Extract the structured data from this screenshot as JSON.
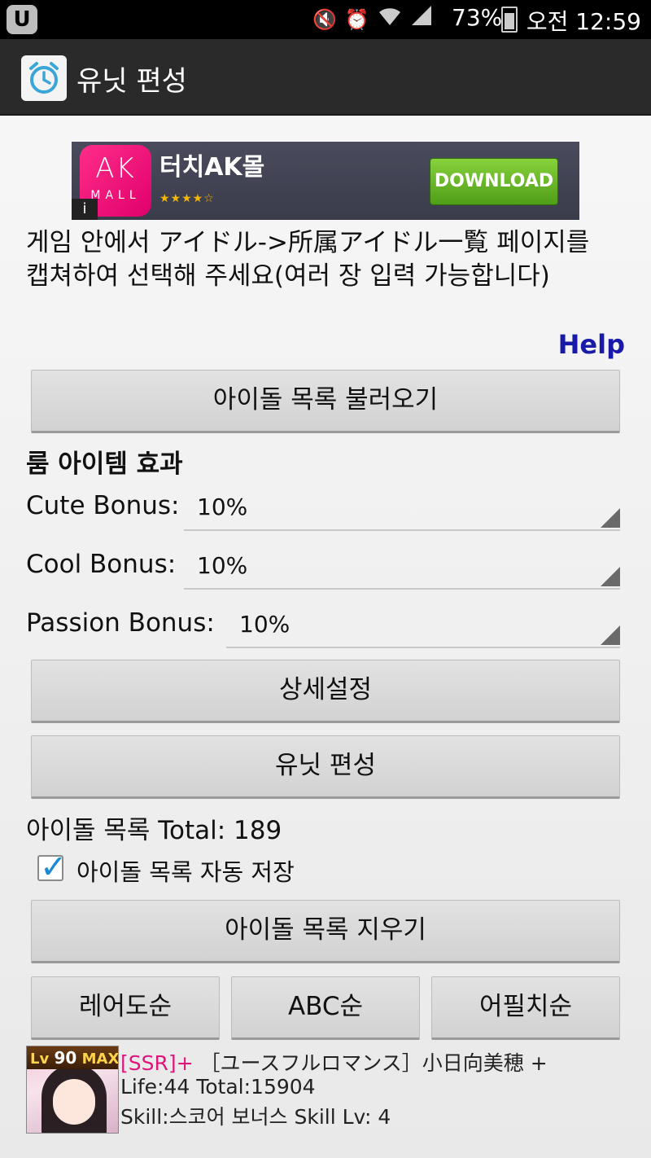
{
  "status_bar": {
    "battery": "73%",
    "time": "오전 12:59"
  },
  "action_bar": {
    "title": "유닛 편성"
  },
  "ad": {
    "logo_text": "AK",
    "logo_subtext": "MALL",
    "info_label": "i",
    "name": "터치AK몰",
    "stars": "★★★★☆",
    "download_label": "DOWNLOAD"
  },
  "instructions": "게임 안에서 アイドル->所属アイドル一覧 페이지를 캡쳐하여 선택해 주세요(여러 장 입력 가능합니다)",
  "help_label": "Help",
  "load_button": "아이돌 목록 불러오기",
  "room_effect_title": "룸 아이템 효과",
  "bonuses": {
    "cute": {
      "label": "Cute Bonus:",
      "value": "10%"
    },
    "cool": {
      "label": "Cool Bonus:",
      "value": "10%"
    },
    "passion": {
      "label": "Passion Bonus:",
      "value": "10%"
    }
  },
  "detail_settings_button": "상세설정",
  "unit_form_button": "유닛 편성",
  "total_label": "아이돌 목록 Total: 189",
  "autosave": {
    "label": "아이돌 목록 자동 저장",
    "checked": true
  },
  "clear_button": "아이돌 목록 지우기",
  "sort_buttons": [
    "레어도순",
    "ABC순",
    "어필치순"
  ],
  "idol": {
    "level_prefix": "Lv",
    "level": "90",
    "level_max": "MAX",
    "rarity": "[SSR]+",
    "name": " ［ユースフルロマンス］小日向美穂 +",
    "stats": "Life:44 Total:15904",
    "skill": "Skill:스코어 보너스 Skill Lv: 4"
  }
}
